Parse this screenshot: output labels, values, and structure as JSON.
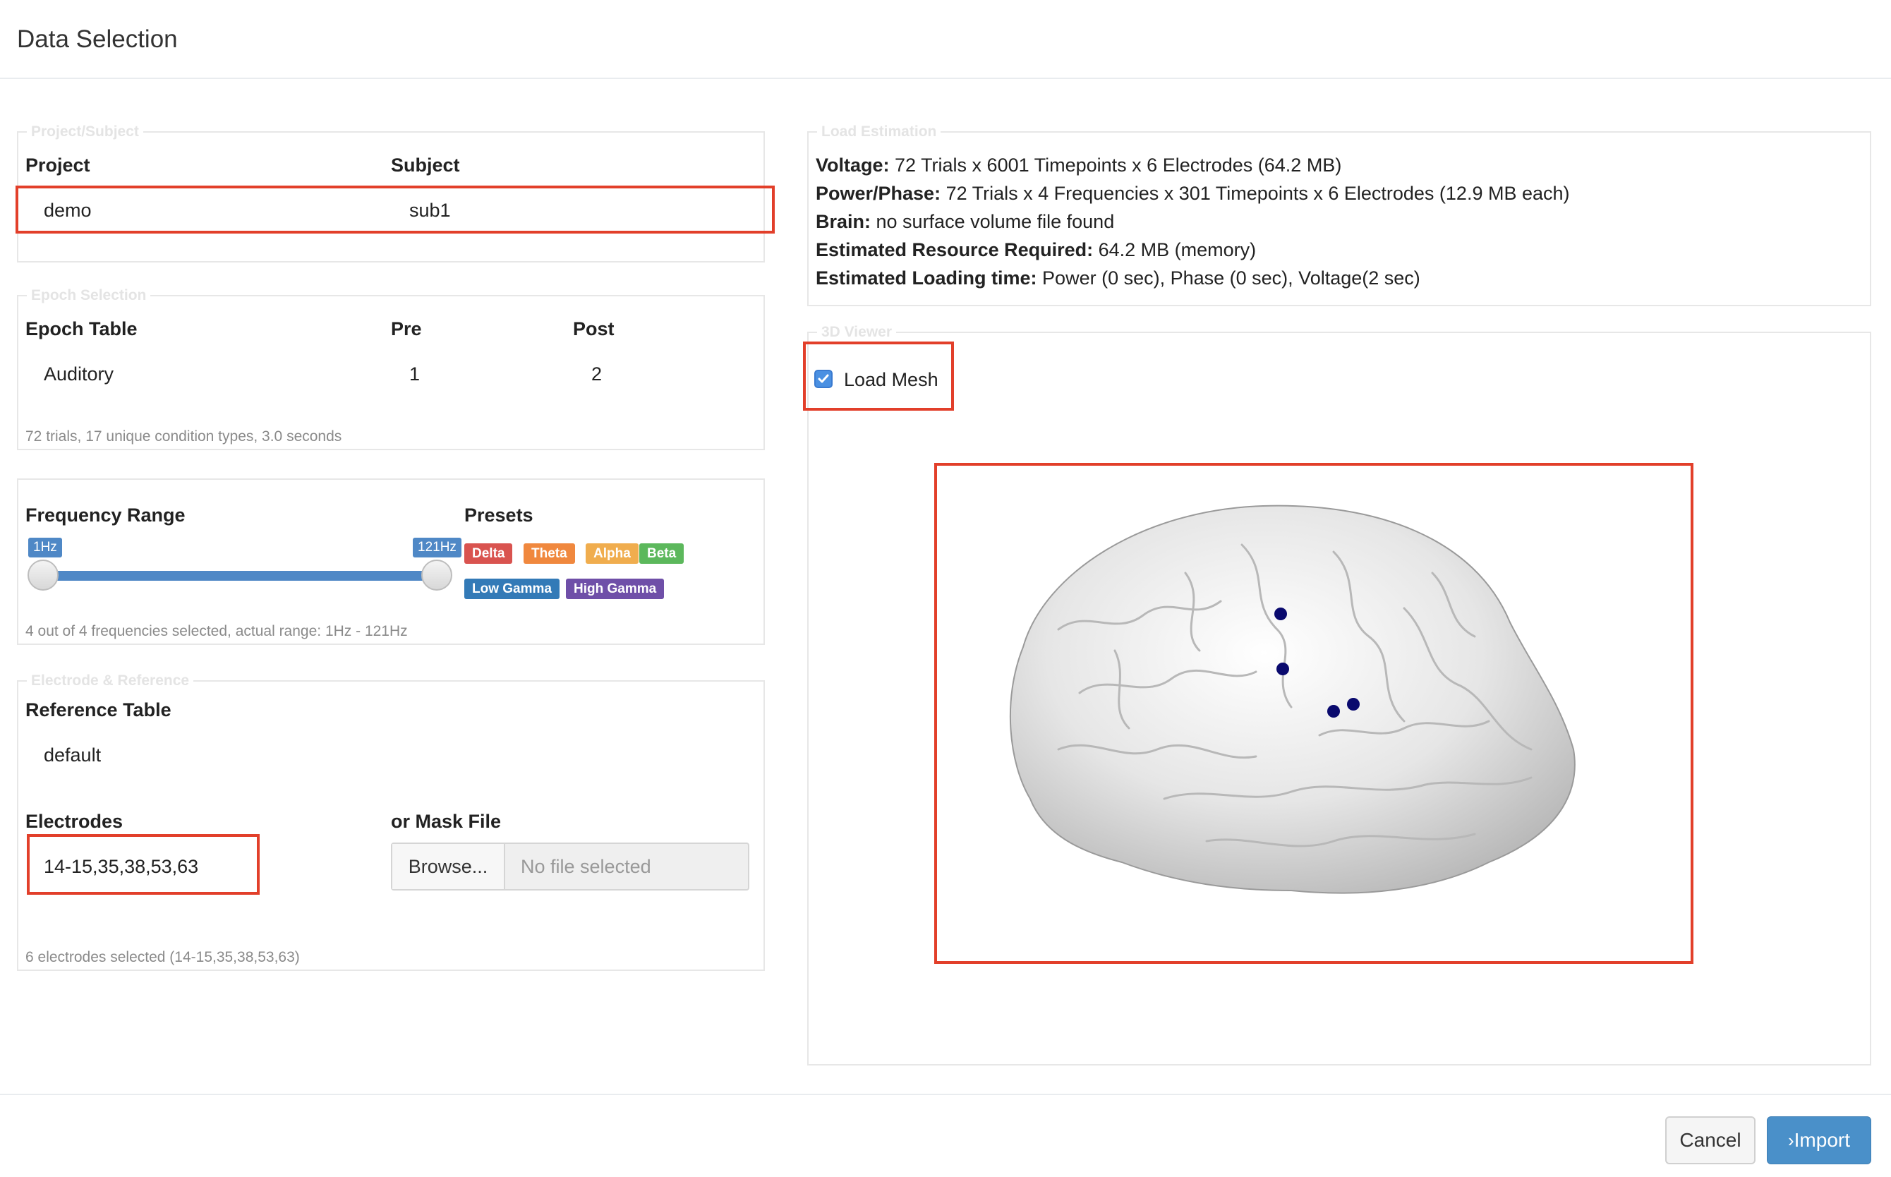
{
  "modal": {
    "title": "Data Selection"
  },
  "project_subject": {
    "legend": "Project/Subject",
    "project_label": "Project",
    "subject_label": "Subject",
    "project_value": "demo",
    "subject_value": "sub1"
  },
  "epoch": {
    "legend": "Epoch Selection",
    "table_label": "Epoch Table",
    "pre_label": "Pre",
    "post_label": "Post",
    "table_value": "Auditory",
    "pre_value": "1",
    "post_value": "2",
    "summary": "72 trials, 17 unique condition types, 3.0 seconds"
  },
  "frequency": {
    "range_label": "Frequency Range",
    "min_label": "1Hz",
    "max_label": "121Hz",
    "min_value": 1,
    "max_value": 121,
    "presets_label": "Presets",
    "presets": [
      {
        "name": "Delta",
        "color": "#d9534f"
      },
      {
        "name": "Theta",
        "color": "#f0883e"
      },
      {
        "name": "Alpha",
        "color": "#f0ad4e"
      },
      {
        "name": "Beta",
        "color": "#5cb85c"
      },
      {
        "name": "Low Gamma",
        "color": "#337ab7"
      },
      {
        "name": "High Gamma",
        "color": "#6f4fa8"
      }
    ],
    "summary": "4 out of 4 frequencies selected, actual range: 1Hz - 121Hz"
  },
  "electrode": {
    "legend": "Electrode & Reference",
    "reference_label": "Reference Table",
    "reference_value": "default",
    "electrodes_label": "Electrodes",
    "electrodes_value": "14-15,35,38,53,63",
    "mask_label": "or Mask File",
    "browse_label": "Browse...",
    "file_placeholder": "No file selected",
    "summary": "6 electrodes selected (14-15,35,38,53,63)"
  },
  "load_estimation": {
    "legend": "Load Estimation",
    "lines": [
      {
        "label": "Voltage:",
        "value": " 72 Trials x 6001 Timepoints x 6 Electrodes (64.2 MB)"
      },
      {
        "label": "Power/Phase:",
        "value": " 72 Trials x 4 Frequencies x 301 Timepoints x 6 Electrodes (12.9 MB each)"
      },
      {
        "label": "Brain:",
        "value": " no surface volume file found"
      },
      {
        "label": "Estimated Resource Required:",
        "value": " 64.2 MB (memory)"
      },
      {
        "label": "Estimated Loading time:",
        "value": " Power (0 sec), Phase (0 sec), Voltage(2 sec)"
      }
    ]
  },
  "viewer": {
    "legend": "3D Viewer",
    "load_mesh_label": "Load Mesh",
    "load_mesh_checked": true,
    "electrode_color": "#0a0a6e"
  },
  "footer": {
    "cancel_label": "Cancel",
    "import_label": "Import",
    "import_color": "#4a90c9"
  },
  "colors": {
    "highlight_box": "#e23f2a",
    "slider_bar": "#4f88c6",
    "slider_label": "#4f88c6"
  }
}
